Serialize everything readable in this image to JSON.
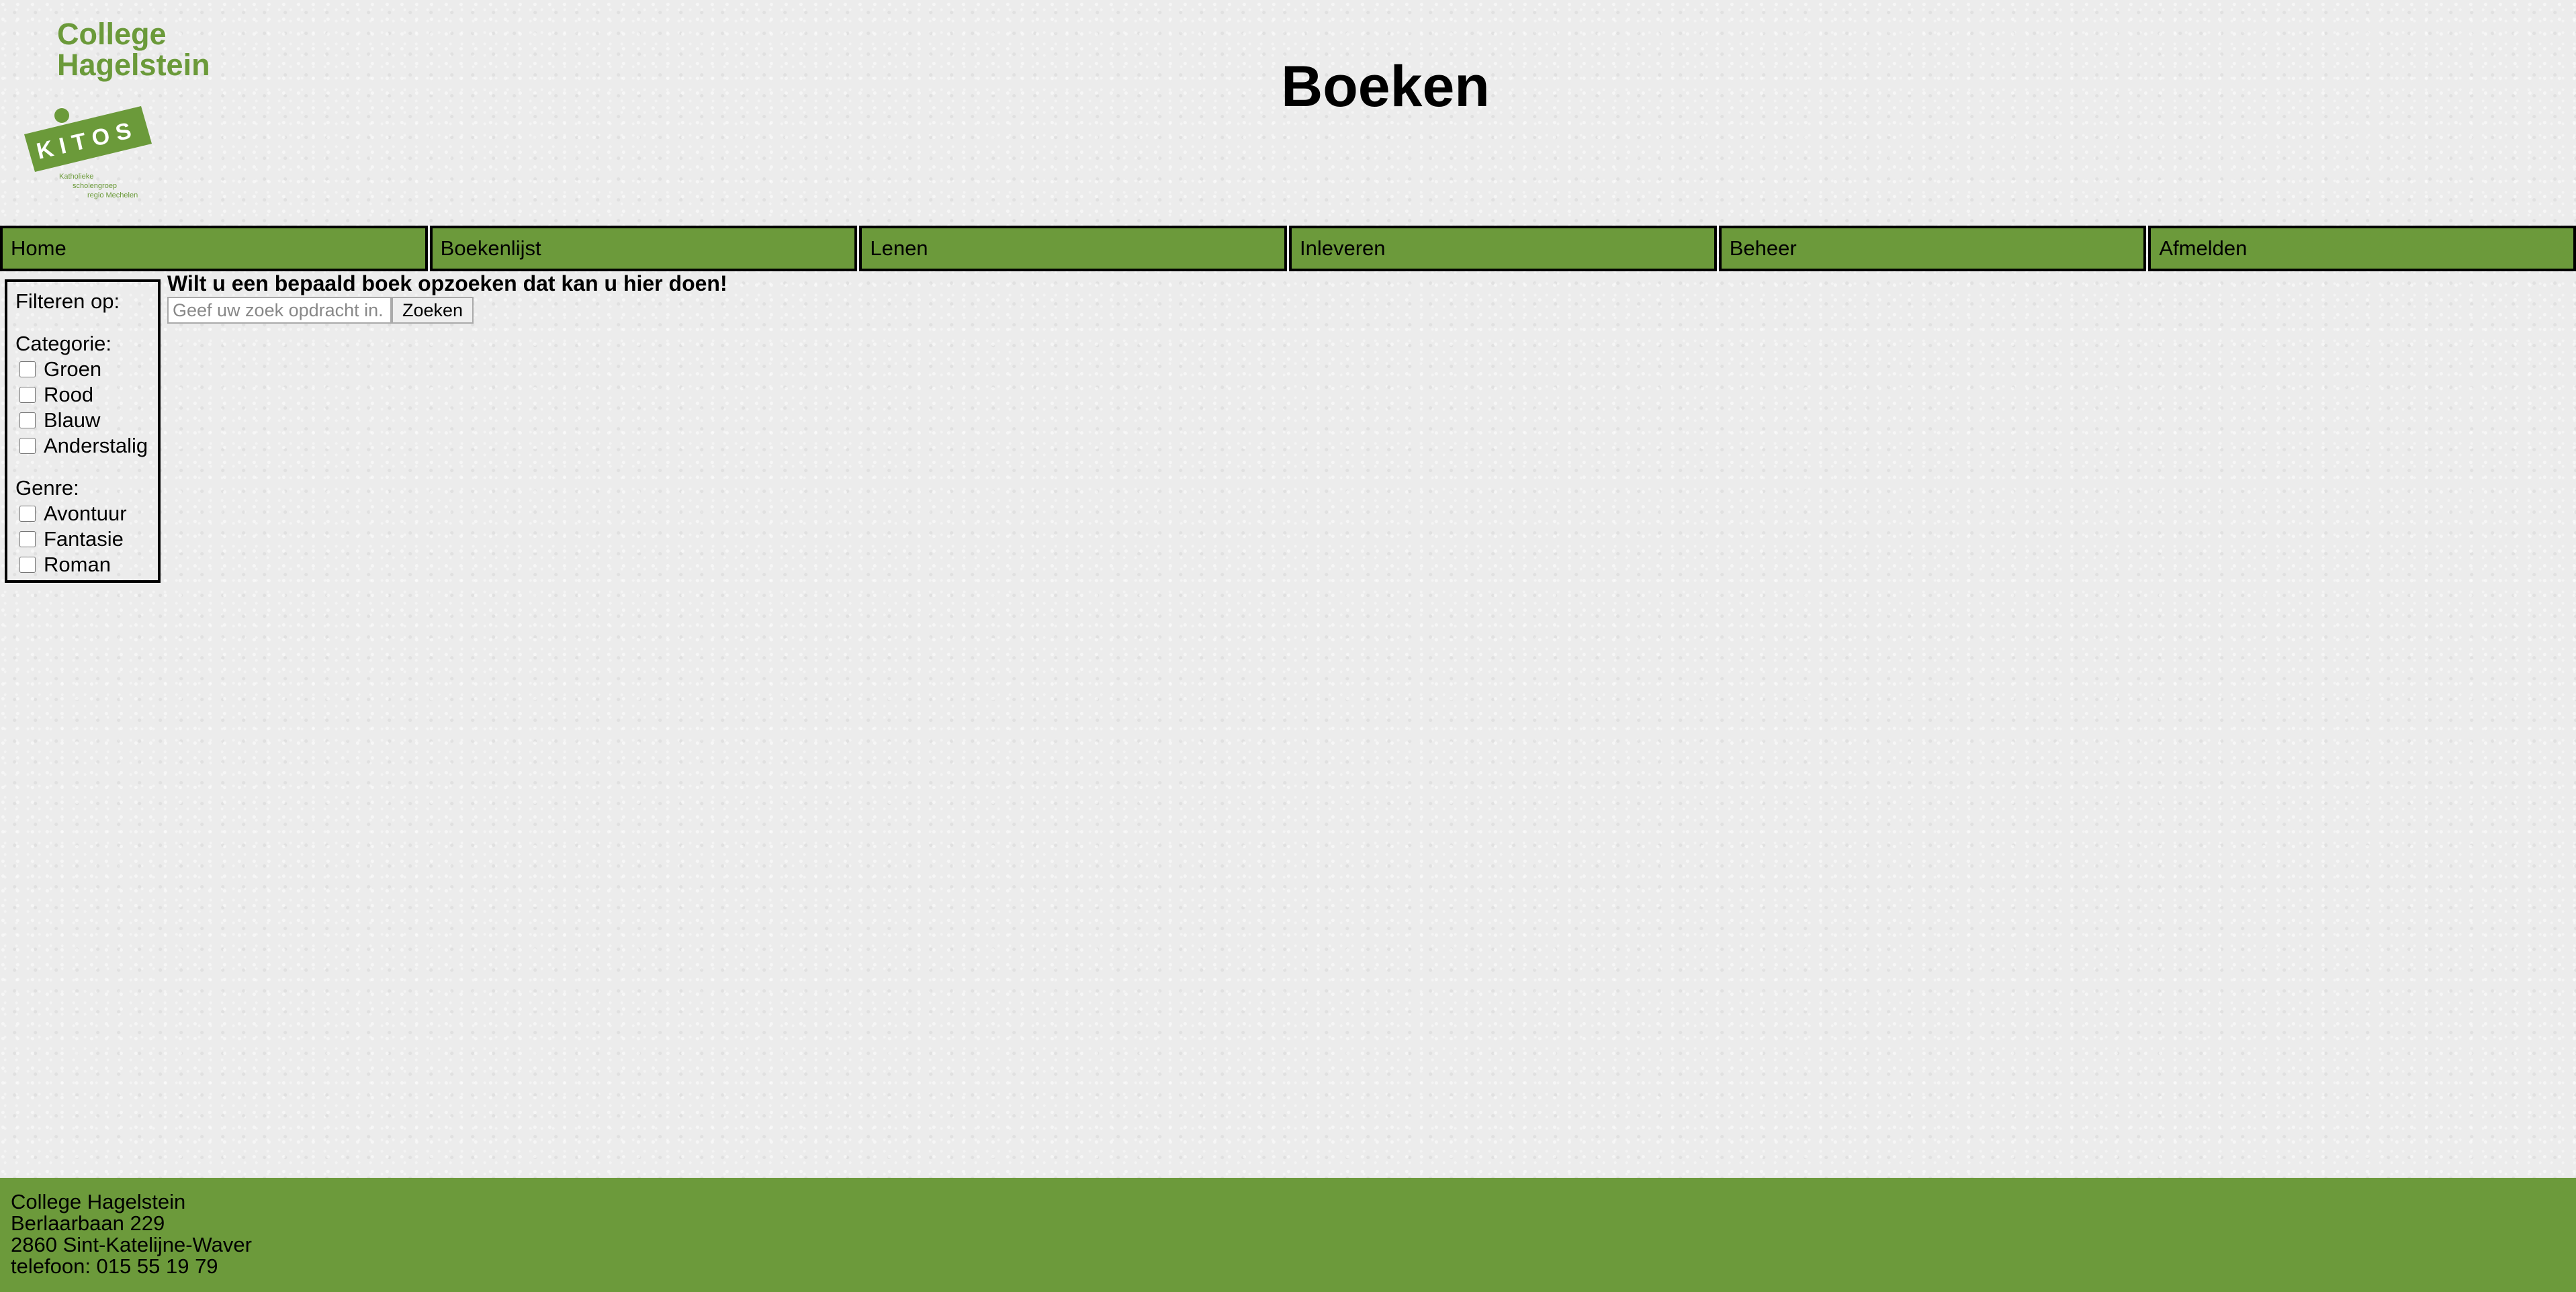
{
  "header": {
    "logo_line1": "College",
    "logo_line2": "Hagelstein",
    "logo_badge": "KITOS",
    "logo_sub1": "Katholieke",
    "logo_sub2": "scholengroep",
    "logo_sub3": "regio Mechelen",
    "title": "Boeken"
  },
  "nav": {
    "items": [
      {
        "label": "Home"
      },
      {
        "label": "Boekenlijst"
      },
      {
        "label": "Lenen"
      },
      {
        "label": "Inleveren"
      },
      {
        "label": "Beheer"
      },
      {
        "label": "Afmelden"
      }
    ]
  },
  "filters": {
    "title": "Filteren op:",
    "category": {
      "label": "Categorie:",
      "options": [
        "Groen",
        "Rood",
        "Blauw",
        "Anderstalig"
      ]
    },
    "genre": {
      "label": "Genre:",
      "options": [
        "Avontuur",
        "Fantasie",
        "Roman"
      ]
    }
  },
  "search": {
    "heading": "Wilt u een bepaald boek opzoeken dat kan u hier doen!",
    "placeholder": "Geef uw zoek opdracht in.",
    "value": "",
    "button_label": "Zoeken"
  },
  "footer": {
    "name": "College Hagelstein",
    "street": "Berlaarbaan 229",
    "city": "2860 Sint-Katelijne-Waver",
    "phone": "telefoon: 015 55 19 79"
  },
  "colors": {
    "brand_green": "#6c9a3b",
    "background": "#ececec"
  }
}
